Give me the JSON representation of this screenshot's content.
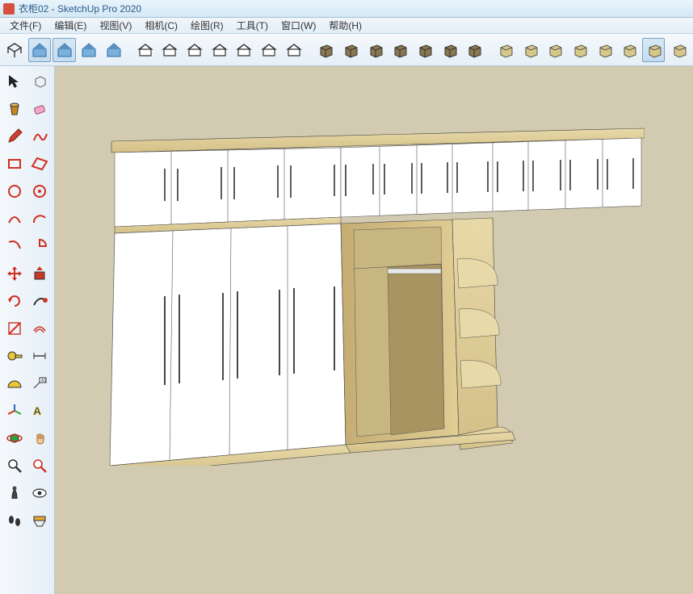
{
  "title": "衣柜02 - SketchUp Pro 2020",
  "menu": [
    "文件(F)",
    "编辑(E)",
    "视图(V)",
    "相机(C)",
    "绘图(R)",
    "工具(T)",
    "窗口(W)",
    "帮助(H)"
  ],
  "toptools": [
    {
      "name": "iso-view",
      "g": "iso"
    },
    {
      "name": "component-1",
      "g": "house",
      "active": true
    },
    {
      "name": "component-2",
      "g": "house",
      "active": true
    },
    {
      "name": "component-3",
      "g": "house"
    },
    {
      "name": "component-4",
      "g": "house"
    },
    {
      "name": "sep"
    },
    {
      "name": "style-1",
      "g": "house2"
    },
    {
      "name": "style-2",
      "g": "house2"
    },
    {
      "name": "style-3",
      "g": "house2"
    },
    {
      "name": "style-4",
      "g": "house2"
    },
    {
      "name": "style-5",
      "g": "house2"
    },
    {
      "name": "style-6",
      "g": "house2"
    },
    {
      "name": "style-7",
      "g": "house2"
    },
    {
      "name": "sep"
    },
    {
      "name": "box-1",
      "g": "box"
    },
    {
      "name": "box-2",
      "g": "box"
    },
    {
      "name": "box-3",
      "g": "box"
    },
    {
      "name": "box-4",
      "g": "box"
    },
    {
      "name": "box-5",
      "g": "box"
    },
    {
      "name": "box-6",
      "g": "box"
    },
    {
      "name": "box-7",
      "g": "box"
    },
    {
      "name": "sep"
    },
    {
      "name": "solid-1",
      "g": "box2"
    },
    {
      "name": "solid-2",
      "g": "box2"
    },
    {
      "name": "solid-3",
      "g": "box2"
    },
    {
      "name": "solid-4",
      "g": "box2"
    },
    {
      "name": "solid-5",
      "g": "box2"
    },
    {
      "name": "solid-6",
      "g": "box2"
    },
    {
      "name": "solid-7",
      "g": "box2",
      "active": true
    },
    {
      "name": "solid-8",
      "g": "box2"
    }
  ],
  "sidetools": [
    {
      "name": "select",
      "g": "arrow"
    },
    {
      "name": "lasso",
      "g": "cube"
    },
    {
      "name": "paint",
      "g": "bucket"
    },
    {
      "name": "eraser",
      "g": "eraser"
    },
    {
      "name": "line",
      "g": "pencil"
    },
    {
      "name": "freehand",
      "g": "squiggle"
    },
    {
      "name": "rectangle",
      "g": "rect"
    },
    {
      "name": "rotated-rect",
      "g": "rrect"
    },
    {
      "name": "circle",
      "g": "circle"
    },
    {
      "name": "polygon",
      "g": "poly"
    },
    {
      "name": "arc",
      "g": "arc"
    },
    {
      "name": "arc2",
      "g": "arc2"
    },
    {
      "name": "arc3",
      "g": "arc3"
    },
    {
      "name": "pie",
      "g": "pie"
    },
    {
      "name": "move",
      "g": "move"
    },
    {
      "name": "pushpull",
      "g": "pushpull"
    },
    {
      "name": "rotate",
      "g": "rotate"
    },
    {
      "name": "followme",
      "g": "follow"
    },
    {
      "name": "scale",
      "g": "scale"
    },
    {
      "name": "offset",
      "g": "offset"
    },
    {
      "name": "tape",
      "g": "tape"
    },
    {
      "name": "dimension",
      "g": "dim"
    },
    {
      "name": "protractor",
      "g": "prot"
    },
    {
      "name": "text",
      "g": "text"
    },
    {
      "name": "axes",
      "g": "axes"
    },
    {
      "name": "3dtext",
      "g": "3dt"
    },
    {
      "name": "orbit",
      "g": "orbit"
    },
    {
      "name": "pan",
      "g": "pan"
    },
    {
      "name": "zoom",
      "g": "zoom"
    },
    {
      "name": "zoom-window",
      "g": "zoomw"
    },
    {
      "name": "position-camera",
      "g": "cam"
    },
    {
      "name": "look-around",
      "g": "eye"
    },
    {
      "name": "walk",
      "g": "walk"
    },
    {
      "name": "section",
      "g": "section"
    }
  ]
}
